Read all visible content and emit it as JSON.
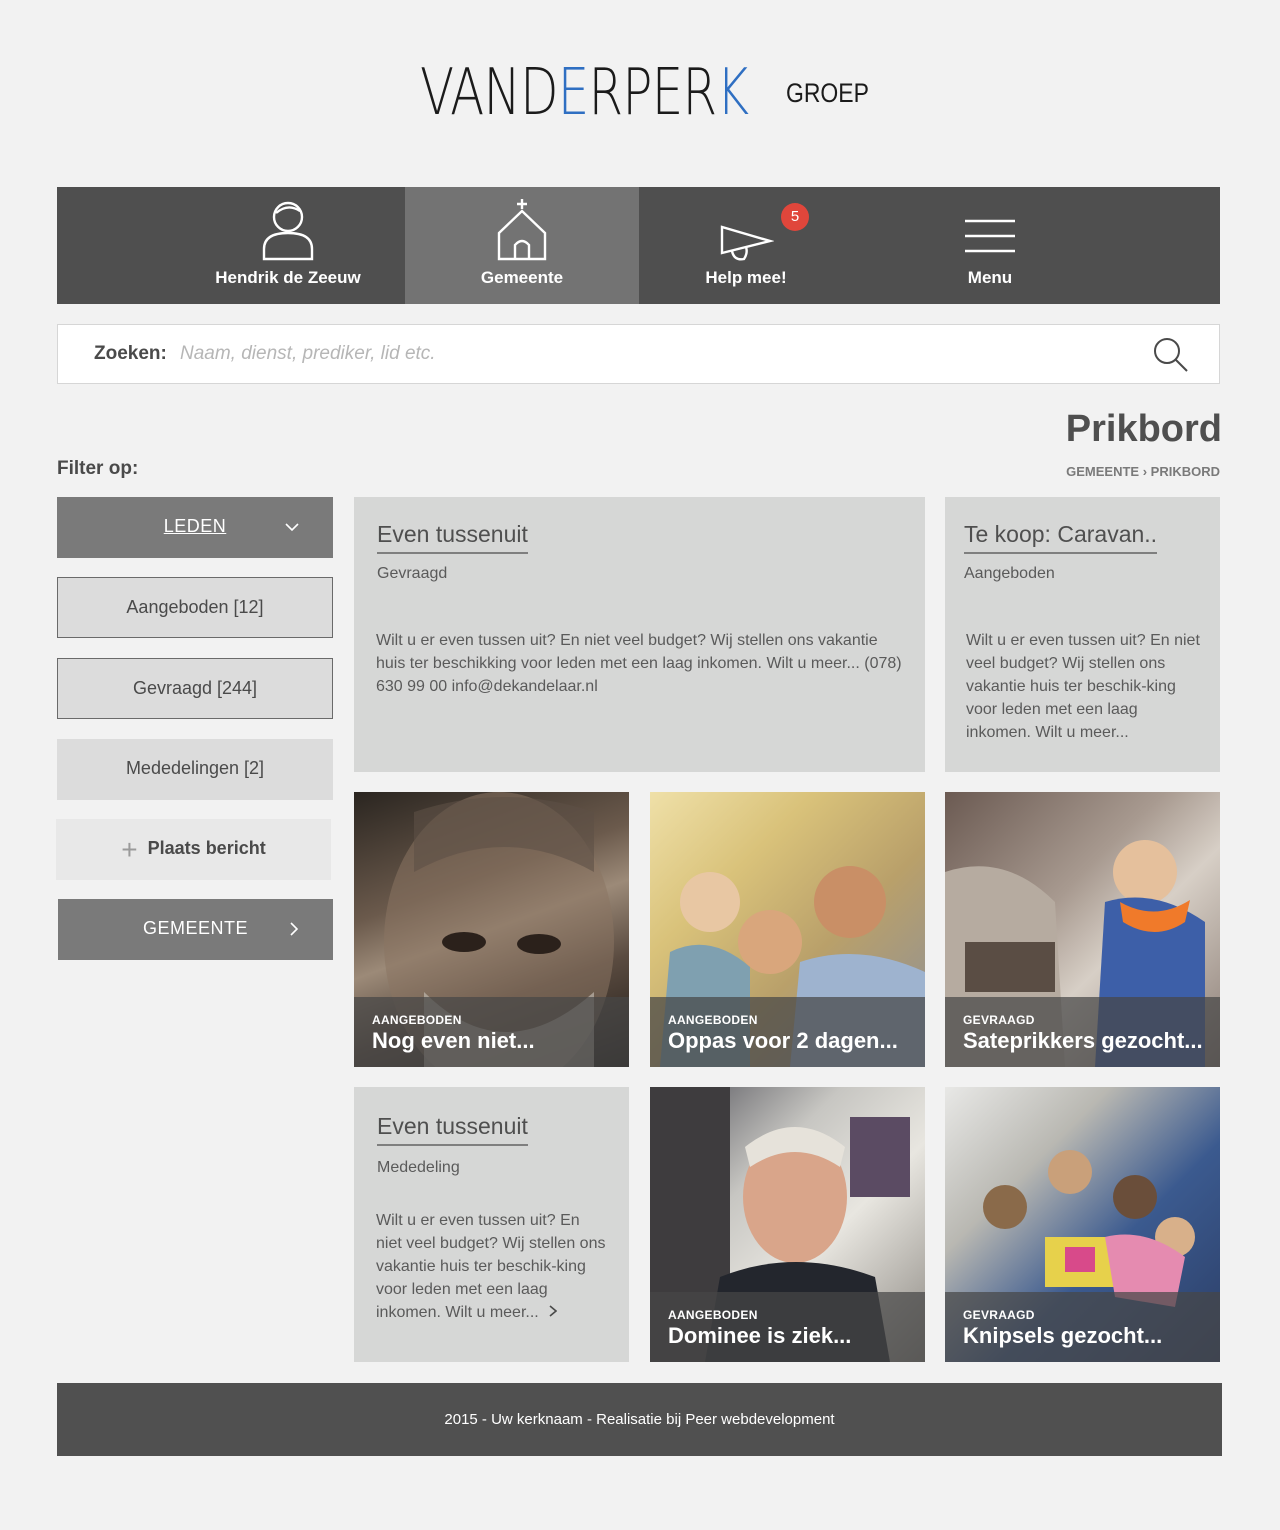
{
  "logo": {
    "main_a": "VAND",
    "main_e": "E",
    "main_b": "RPER",
    "main_k": "K",
    "sub": "GROEP"
  },
  "nav": {
    "items": [
      {
        "label": "Hendrik de Zeeuw",
        "icon": "user-icon"
      },
      {
        "label": "Gemeente",
        "icon": "church-icon",
        "active": true
      },
      {
        "label": "Help mee!",
        "icon": "megaphone-icon",
        "badge": "5"
      },
      {
        "label": "Menu",
        "icon": "hamburger-icon"
      }
    ]
  },
  "search": {
    "label": "Zoeken:",
    "placeholder": "Naam, dienst, prediker, lid etc.",
    "value": ""
  },
  "page": {
    "title": "Prikbord",
    "breadcrumb": [
      "GEMEENTE",
      "PRIKBORD"
    ],
    "filter_label": "Filter op:"
  },
  "sidebar": {
    "leden": "LEDEN",
    "aangeboden": "Aangeboden [12]",
    "gevraagd": "Gevraagd [244]",
    "mededelingen": "Mededelingen [2]",
    "plaats": "Plaats bericht",
    "gemeente": "GEMEENTE"
  },
  "cards": {
    "c1": {
      "title": "Even tussenuit",
      "type": "Gevraagd",
      "body": "Wilt u er even tussen uit? En niet veel budget? Wij stellen ons vakantie huis ter beschikking voor leden met een laag inkomen. Wilt u meer... (078) 630 99 00 info@dekandelaar.nl"
    },
    "c2": {
      "title": "Te koop: Caravan..",
      "type": "Aangeboden",
      "body": "Wilt u er even tussen uit? En niet veel budget? Wij stellen ons vakantie huis ter beschik-king voor leden met een laag inkomen. Wilt u meer..."
    },
    "c3": {
      "title": "Even tussenuit",
      "type": "Mededeling",
      "body": "Wilt u er even tussen uit? En niet veel budget? Wij stellen ons vakantie huis ter beschik-king voor leden met een laag inkomen. Wilt u meer..."
    }
  },
  "photos": [
    {
      "tag": "AANGEBODEN",
      "title": "Nog even niet..."
    },
    {
      "tag": "AANGEBODEN",
      "title": "Oppas voor 2 dagen..."
    },
    {
      "tag": "GEVRAAGD",
      "title": "Sateprikkers gezocht..."
    },
    {
      "tag": "AANGEBODEN",
      "title": "Dominee is ziek..."
    },
    {
      "tag": "GEVRAAGD",
      "title": "Knipsels gezocht..."
    }
  ],
  "footer": "2015 - Uw kerknaam - Realisatie bij Peer webdevelopment",
  "colors": {
    "accent_blue": "#2f6fc2",
    "badge_red": "#e0463b",
    "nav_bg": "#4f4f4f",
    "nav_active": "#737373",
    "footer_bg": "#505050"
  }
}
